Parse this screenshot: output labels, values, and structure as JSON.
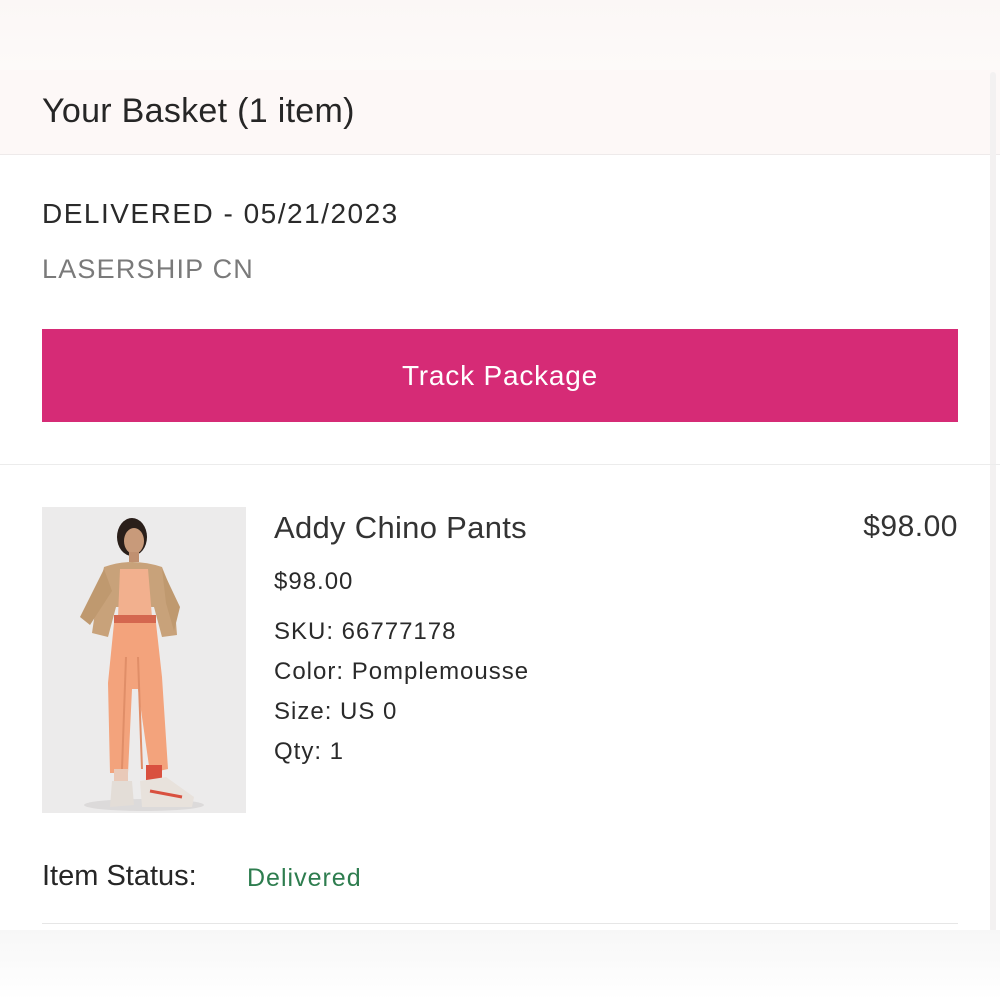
{
  "header": {
    "title": "Your Basket (1 item)"
  },
  "shipment": {
    "status": "DELIVERED - 05/21/2023",
    "carrier": "LASERSHIP CN",
    "track_button_label": "Track Package"
  },
  "item": {
    "name": "Addy Chino Pants",
    "total": "$98.00",
    "unit_price": "$98.00",
    "sku": "SKU: 66777178",
    "color": "Color: Pomplemousse",
    "size": "Size: US 0",
    "qty": "Qty: 1",
    "image_icon": "product-photo"
  },
  "status": {
    "label": "Item Status:",
    "value": "Delivered"
  },
  "colors": {
    "accent": "#d62b76",
    "status_green": "#2e7d4f"
  }
}
